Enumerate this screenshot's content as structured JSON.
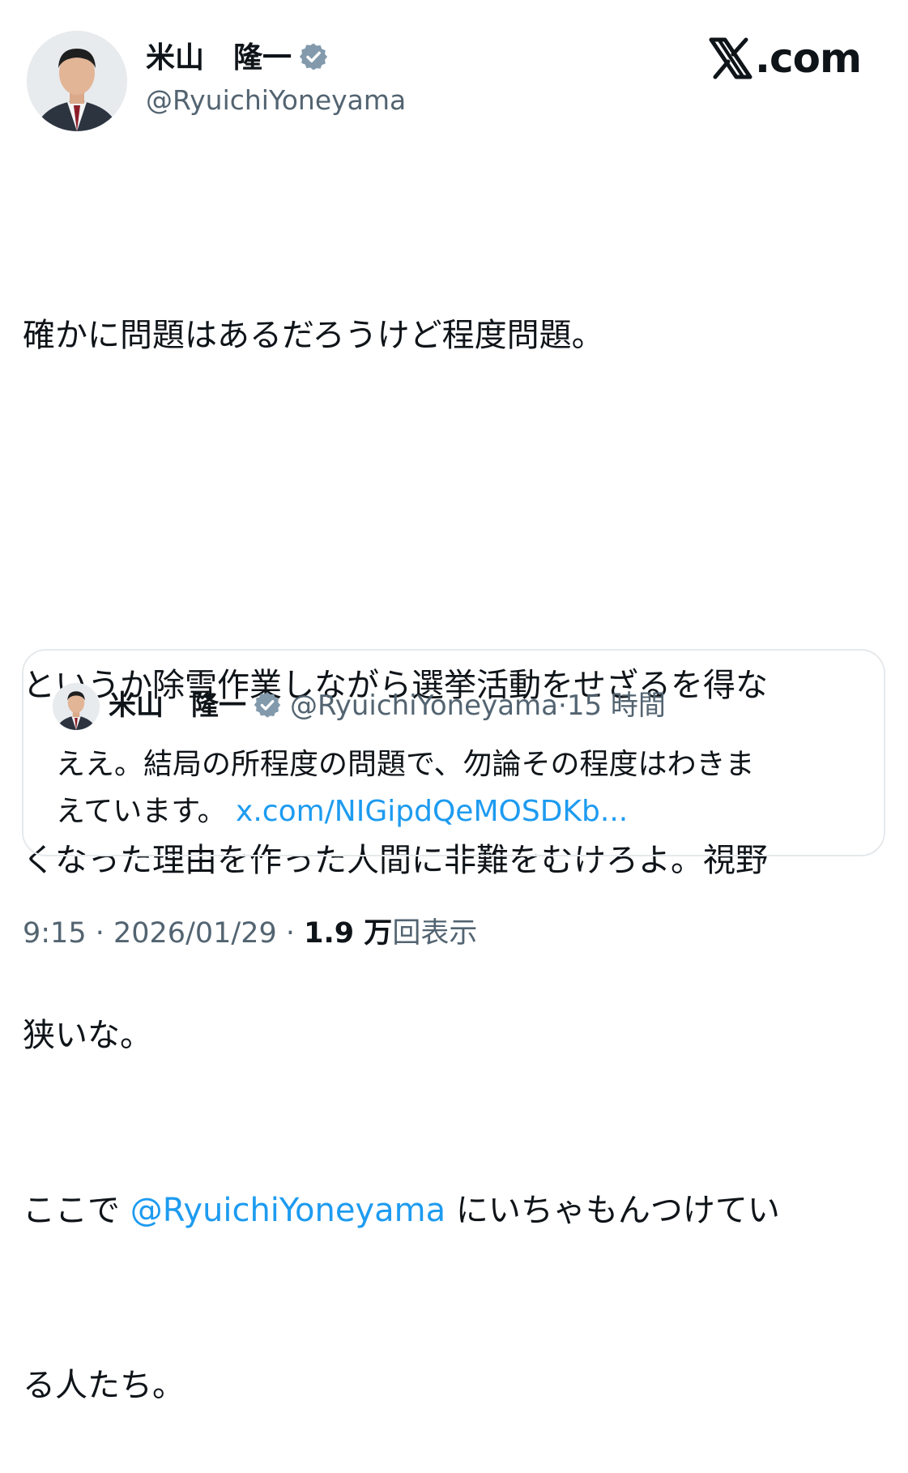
{
  "author": {
    "name": "米山　隆一",
    "handle": "@RyuichiYoneyama",
    "verified": true,
    "verified_color": "#829aab"
  },
  "brand": {
    "x_glyph": "𝕏",
    "text": ".com"
  },
  "tweet": {
    "lines": [
      "確かに問題はあるだろうけど程度問題。",
      "",
      "というか除雪作業しながら選挙活動をせざるを得な",
      "くなった理由を作った人間に非難をむけろよ。視野",
      "狭いな。"
    ],
    "mention_line": {
      "before": "ここで ",
      "mention": "@RyuichiYoneyama",
      "after": " にいちゃもんつけてい"
    },
    "last_line": "る人たち。"
  },
  "quote": {
    "name": "米山　隆一",
    "handle": "@RyuichiYoneyama",
    "dot": "·",
    "time": "15 時間",
    "text_line1": "ええ。結局の所程度の問題で、勿論その程度はわきま",
    "text_line2": "えています。 ",
    "link": "x.com/NIGipdQeMOSDKb..."
  },
  "meta": {
    "time": "9:15",
    "sep1": " · ",
    "date": "2026/01/29",
    "sep2": " · ",
    "views_count": "1.9 万",
    "views_label": "回表示"
  },
  "colors": {
    "text": "#0f1419",
    "secondary": "#536471",
    "link": "#1d9bf0",
    "border": "#e6e9ec"
  }
}
